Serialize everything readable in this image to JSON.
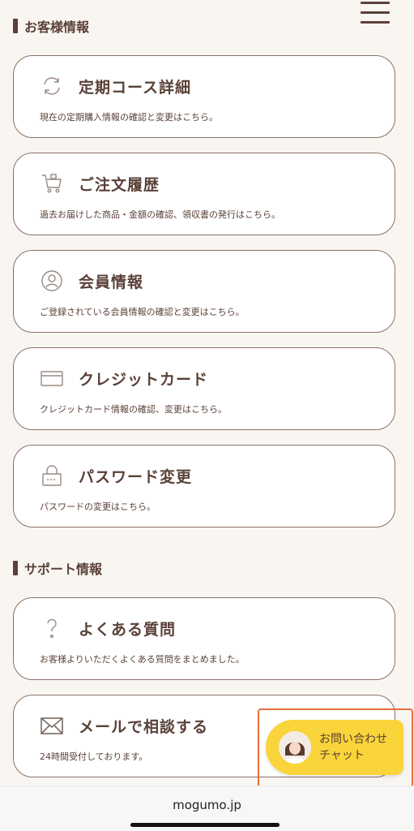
{
  "sections": {
    "customer": "お客様情報",
    "support": "サポート情報"
  },
  "cards": [
    {
      "title": "定期コース詳細",
      "desc": "現在の定期購入情報の確認と変更はこちら。",
      "icon": "refresh-icon"
    },
    {
      "title": "ご注文履歴",
      "desc": "過去お届けした商品・金額の確認、領収書の発行はこちら。",
      "icon": "cart-icon"
    },
    {
      "title": "会員情報",
      "desc": "ご登録されている会員情報の確認と変更はこちら。",
      "icon": "user-icon"
    },
    {
      "title": "クレジットカード",
      "desc": "クレジットカード情報の確認、変更はこちら。",
      "icon": "credit-card-icon"
    },
    {
      "title": "パスワード変更",
      "desc": "パスワードの変更はこちら。",
      "icon": "lock-icon"
    },
    {
      "title": "よくある質問",
      "desc": "お客様よりいただくよくある質問をまとめました。",
      "icon": "question-icon"
    },
    {
      "title": "メールで相談する",
      "desc": "24時間受付しております。",
      "icon": "mail-icon"
    }
  ],
  "chat": {
    "line1": "お問い合わせ",
    "line2": "チャット"
  },
  "footer": {
    "domain": "mogumo.jp"
  },
  "colors": {
    "background": "#f9f6f2",
    "text": "#5a4138",
    "chat_button": "#f9d43a",
    "highlight": "#e87038"
  }
}
